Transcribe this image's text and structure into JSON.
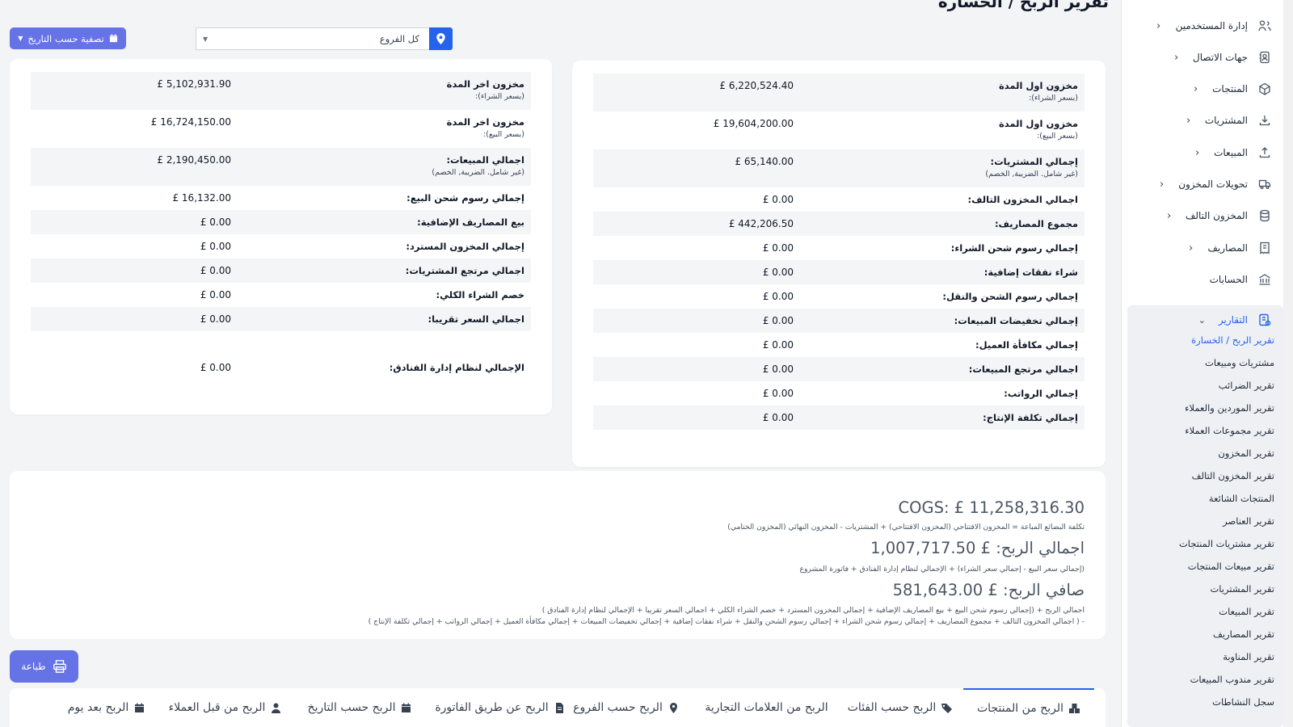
{
  "page": {
    "title": "تقرير الربح / الخسارة"
  },
  "filters": {
    "date_filter_label": "تصفية حسب التاريخ",
    "branch_value": "كل الفروع"
  },
  "sidebar": {
    "items": [
      {
        "label": "إدارة المستخدمين",
        "icon": "users-icon",
        "chevron": true
      },
      {
        "label": "جهات الاتصال",
        "icon": "contacts-icon",
        "chevron": true
      },
      {
        "label": "المنتجات",
        "icon": "box-icon",
        "chevron": true
      },
      {
        "label": "المشتريات",
        "icon": "download-icon",
        "chevron": true
      },
      {
        "label": "المبيعات",
        "icon": "upload-icon",
        "chevron": true
      },
      {
        "label": "تحويلات المخزون",
        "icon": "truck-icon",
        "chevron": true
      },
      {
        "label": "المخزون التالف",
        "icon": "database-icon",
        "chevron": true
      },
      {
        "label": "المصاريف",
        "icon": "receipt-icon",
        "chevron": true
      },
      {
        "label": "الحسابات",
        "icon": "bank-icon",
        "chevron": false
      }
    ],
    "reports": {
      "label": "التقارير",
      "items": [
        {
          "label": "تقرير الربح / الخسارة",
          "active": true
        },
        {
          "label": "مشتريات ومبيعات"
        },
        {
          "label": "تقرير الضرائب"
        },
        {
          "label": "تقرير الموردين والعملاء"
        },
        {
          "label": "تقرير مجموعات العملاء"
        },
        {
          "label": "تقرير المخزون"
        },
        {
          "label": "تقرير المخزون التالف"
        },
        {
          "label": "المنتجات الشائعة"
        },
        {
          "label": "تقرير العناصر"
        },
        {
          "label": "تقرير مشتريات المنتجات"
        },
        {
          "label": "تقرير مبيعات المنتجات"
        },
        {
          "label": "تقرير المشتريات"
        },
        {
          "label": "تقرير المبيعات"
        },
        {
          "label": "تقرير المصاريف"
        },
        {
          "label": "تقرير المناوبة"
        },
        {
          "label": "تقرير مندوب المبيعات"
        },
        {
          "label": "سجل النشاطات"
        }
      ]
    }
  },
  "right_card": {
    "rows": [
      {
        "label": "مخزون اول المدة",
        "sub": "(بسعر الشراء):",
        "value": "£ 6,220,524.40"
      },
      {
        "label": "مخزون اول المدة",
        "sub": "(بسعر البيع):",
        "value": "£ 19,604,200.00"
      },
      {
        "label": "إجمالي المشتريات:",
        "sub": "(غير شامل. الضريبة, الخصم)",
        "value": "£ 65,140.00"
      },
      {
        "label": "اجمالي المخزون التالف:",
        "sub": "",
        "value": "£ 0.00"
      },
      {
        "label": "مجموع المصاريف:",
        "sub": "",
        "value": "£ 442,206.50"
      },
      {
        "label": "إجمالي رسوم شحن الشراء:",
        "sub": "",
        "value": "£ 0.00"
      },
      {
        "label": "شراء نفقات إضافية:",
        "sub": "",
        "value": "£ 0.00"
      },
      {
        "label": "إجمالي رسوم الشحن والنقل:",
        "sub": "",
        "value": "£ 0.00"
      },
      {
        "label": "إجمالي تخفيضات المبيعات:",
        "sub": "",
        "value": "£ 0.00"
      },
      {
        "label": "إجمالي مكافأة العميل:",
        "sub": "",
        "value": "£ 0.00"
      },
      {
        "label": "اجمالي مرتجع المبيعات:",
        "sub": "",
        "value": "£ 0.00"
      },
      {
        "label": "إجمالي الرواتب:",
        "sub": "",
        "value": "£ 0.00"
      },
      {
        "label": "إجمالي تكلفة الإنتاج:",
        "sub": "",
        "value": "£ 0.00"
      }
    ]
  },
  "left_card": {
    "rows": [
      {
        "label": "مخزون اخر المدة",
        "sub": "(بسعر الشراء):",
        "value": "£ 5,102,931.90"
      },
      {
        "label": "مخزون اخر المدة",
        "sub": "(بسعر البيع):",
        "value": "£ 16,724,150.00"
      },
      {
        "label": "اجمالي المبيعات:",
        "sub": "(غير شامل. الضريبة, الخصم)",
        "value": "£ 2,190,450.00"
      },
      {
        "label": "إجمالي رسوم شحن البيع:",
        "sub": "",
        "value": "£ 16,132.00"
      },
      {
        "label": "بيع المصاريف الإضافية:",
        "sub": "",
        "value": "£ 0.00"
      },
      {
        "label": "إجمالي المخزون المسترد:",
        "sub": "",
        "value": "£ 0.00"
      },
      {
        "label": "اجمالي مرتجع المشتريات:",
        "sub": "",
        "value": "£ 0.00"
      },
      {
        "label": "خصم الشراء الكلي:",
        "sub": "",
        "value": "£ 0.00"
      },
      {
        "label": "اجمالي السعر تقريبا:",
        "sub": "",
        "value": "£ 0.00"
      },
      {
        "label": "الإجمالي لنظام إدارة الفنادق:",
        "sub": "",
        "value": "£ 0.00"
      }
    ]
  },
  "summary": {
    "cogs": "COGS: £ 11,258,316.30",
    "cogs_formula": "تكلفة البضائع المباعة = المخزون الافتتاحي (المخزون الافتتاحي) + المشتريات - المخزون النهائي (المخزون الختامي)",
    "gross": "اجمالي الربح: £ 1,007,717.50",
    "gross_formula": "(إجمالي سعر البيع - إجمالي سعر الشراء) + الإجمالي لنظام إدارة الفنادق + فاتورة المشروع",
    "net": "صافي الربح: £ 581,643.00",
    "net_formula_1": "اجمالي الربح + (إجمالي رسوم شحن البيع + بيع المصاريف الإضافية + إجمالي المخزون المسترد + خصم الشراء الكلي + اجمالي السعر تقريبا + الإجمالي لنظام إدارة الفنادق )",
    "net_formula_2": "- ( اجمالي المخزون التالف + مجموع المصاريف + إجمالي رسوم شحن الشراء + إجمالي رسوم الشحن والنقل + شراء نفقات إضافية + إجمالي تخفيضات المبيعات + إجمالي مكافأة العميل + إجمالي الرواتب + إجمالي تكلفة الإنتاج )"
  },
  "print_label": "طباعة",
  "tabs": [
    {
      "label": "الربح من المنتجات",
      "icon": "cubes-icon",
      "active": true
    },
    {
      "label": "الربح حسب الفئات",
      "icon": "tags-icon"
    },
    {
      "label": "الربح من العلامات التجارية",
      "icon": ""
    },
    {
      "label": "الربح حسب الفروع",
      "icon": "map-marker-icon"
    },
    {
      "label": "الربح عن طريق الفاتورة",
      "icon": "file-icon"
    },
    {
      "label": "الربح حسب التاريخ",
      "icon": "calendar-icon"
    },
    {
      "label": "الربح من قبل العملاء",
      "icon": "user-icon"
    },
    {
      "label": "الربح بعد يوم",
      "icon": "calendar-icon"
    }
  ]
}
